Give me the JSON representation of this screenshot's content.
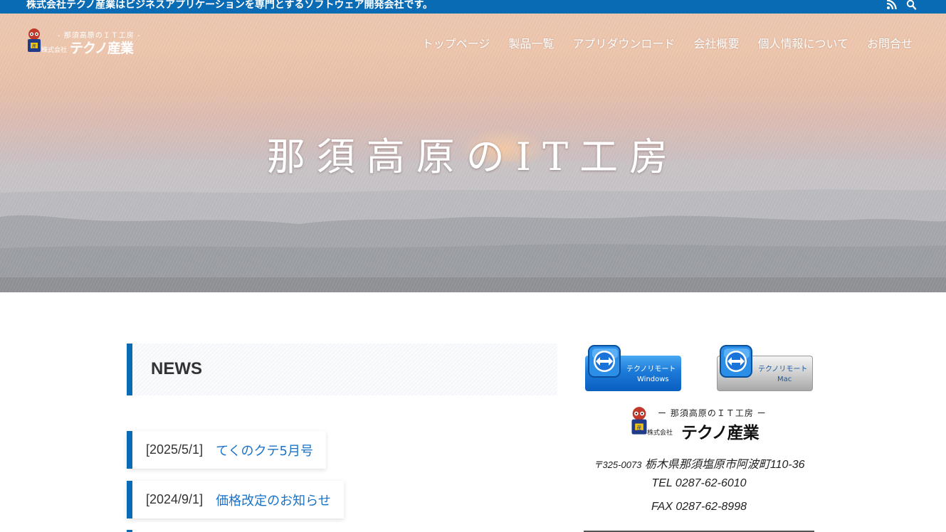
{
  "topbar": {
    "tagline": "株式会社テクノ産業はビジネスアプリケーションを専門とするソフトウェア開発会社です。",
    "icons": [
      "rss-icon",
      "search-icon"
    ]
  },
  "header": {
    "logo": {
      "sub": "- 那須高原のＩＴ工房 -",
      "prefix": "株式会社",
      "name": "テクノ産業"
    },
    "nav": [
      {
        "label": "トップページ"
      },
      {
        "label": "製品一覧"
      },
      {
        "label": "アプリダウンロード"
      },
      {
        "label": "会社概要"
      },
      {
        "label": "個人情報について"
      },
      {
        "label": "お問合せ"
      }
    ]
  },
  "hero": {
    "title": "那須高原のIT工房"
  },
  "news": {
    "heading": "NEWS",
    "items": [
      {
        "date": "[2025/5/1]",
        "title": "てくのクテ5月号"
      },
      {
        "date": "[2024/9/1]",
        "title": "価格改定のお知らせ"
      }
    ]
  },
  "sidebar": {
    "remote_windows": {
      "label": "テクノリモート",
      "platform": "Windows"
    },
    "remote_mac": {
      "label": "テクノリモート",
      "platform": "Mac"
    },
    "logo": {
      "sub": "ー 那須高原のＩＴ工房 ー",
      "prefix": "株式会社",
      "name": "テクノ産業"
    },
    "postal": "〒325-0073",
    "address": "栃木県那須塩原市阿波町110-36",
    "tel": "TEL 0287-62-6010",
    "fax": "FAX 0287-62-8998"
  },
  "colors": {
    "brand_blue": "#0a6bb5",
    "link_blue": "#1a73c8"
  }
}
